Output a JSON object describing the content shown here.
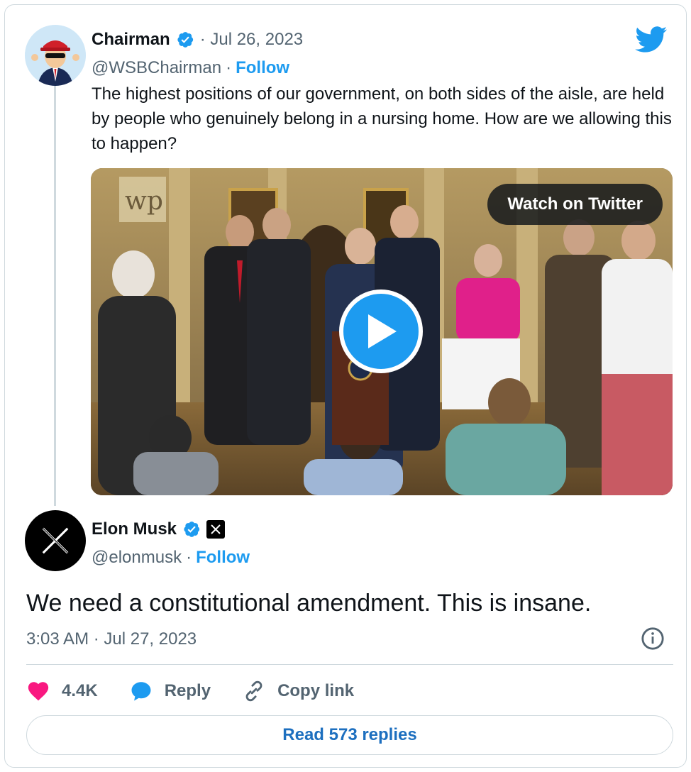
{
  "colors": {
    "brand_blue": "#1d9bf0",
    "text": "#0f1419",
    "muted": "#536471",
    "like_pink": "#f91880",
    "border": "#cfd9de"
  },
  "parent_tweet": {
    "author_name": "Chairman",
    "date": "· Jul 26, 2023",
    "handle": "@WSBChairman",
    "separator": "·",
    "follow_label": "Follow",
    "text": "The highest positions of our government, on both sides of the aisle, are held by people who genuinely belong in a nursing home. How are we allowing this to happen?",
    "media": {
      "watch_label": "Watch on Twitter",
      "watermark": "wp",
      "icon": "play-icon"
    }
  },
  "main_tweet": {
    "author_name": "Elon Musk",
    "handle": "@elonmusk",
    "separator": "·",
    "follow_label": "Follow",
    "text": "We need a constitutional amendment. This is insane.",
    "timestamp": "3:03 AM · Jul 27, 2023"
  },
  "actions": {
    "likes": "4.4K",
    "reply_label": "Reply",
    "copy_link_label": "Copy link"
  },
  "read_replies_label": "Read 573 replies",
  "icons": [
    "twitter-bird-icon",
    "verified-badge-icon",
    "x-logo-icon",
    "play-icon",
    "info-icon",
    "heart-icon",
    "reply-bubble-icon",
    "link-icon"
  ]
}
